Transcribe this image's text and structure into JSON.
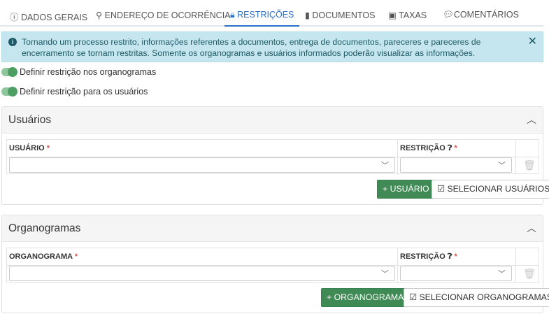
{
  "tabs": [
    {
      "label": "DADOS GERAIS",
      "icon": "info-circle-icon"
    },
    {
      "label": "ENDEREÇO DE OCORRÊNCIA",
      "icon": "map-marker-icon"
    },
    {
      "label": "RESTRIÇÕES",
      "icon": "lock-icon",
      "active": true
    },
    {
      "label": "DOCUMENTOS",
      "icon": "file-icon"
    },
    {
      "label": "TAXAS",
      "icon": "money-icon"
    },
    {
      "label": "COMENTÁRIOS",
      "icon": "comment-icon"
    }
  ],
  "alert": {
    "text": "Tornando um processo restrito, informações referentes a documentos, entrega de documentos, pareceres e pareceres de encerramento se tornam restritas. Somente os organogramas e usuários informados poderão visualizar as informações."
  },
  "toggles": [
    {
      "label": "Definir restrição nos organogramas",
      "on": true
    },
    {
      "label": "Definir restrição para os usuários",
      "on": true
    }
  ],
  "usuarios": {
    "title": "Usuários",
    "col1": "USUÁRIO",
    "col2": "RESTRIÇÃO",
    "required": "*",
    "add": "+ USUÁRIO",
    "select": "SELECIONAR USUÁRIOS"
  },
  "organogramas": {
    "title": "Organogramas",
    "col1": "ORGANOGRAMA",
    "col2": "RESTRIÇÃO",
    "required": "*",
    "add": "+ ORGANOGRAMA",
    "select": "SELECIONAR ORGANOGRAMAS"
  }
}
